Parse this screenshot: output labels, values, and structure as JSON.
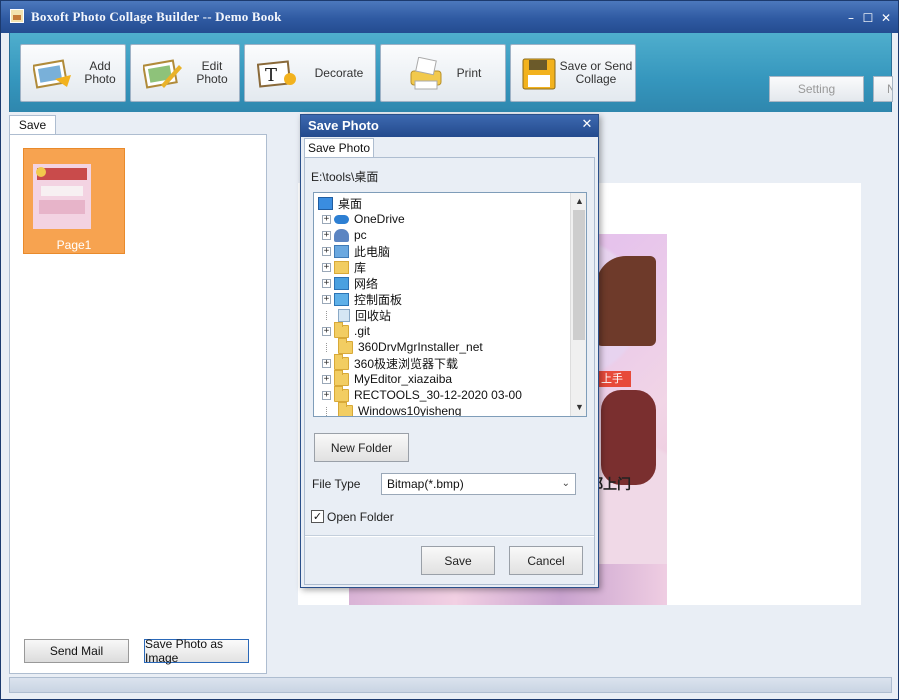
{
  "window": {
    "title": "Boxoft Photo Collage Builder -- Demo Book"
  },
  "toolbar": {
    "add_photo": "Add\nPhoto",
    "edit_photo": "Edit\nPhoto",
    "decorate": "Decorate",
    "print": "Print",
    "save_or_send": "Save or Send\nCollage",
    "setting": "Setting",
    "next_partial": "N"
  },
  "left_panel": {
    "tab": "Save",
    "thumbnail_caption": "Page1",
    "send_mail": "Send Mail",
    "save_photo_as_image": "Save Photo as Image"
  },
  "dialog": {
    "title": "Save Photo",
    "tab": "Save Photo",
    "path": "E:\\tools\\桌面",
    "tree": [
      {
        "label": "桌面",
        "icon": "desktop-icon",
        "level": 0,
        "expander": "none"
      },
      {
        "label": "OneDrive",
        "icon": "cloud-icon",
        "level": 1,
        "expander": "+"
      },
      {
        "label": "pc",
        "icon": "user-icon",
        "level": 1,
        "expander": "+"
      },
      {
        "label": "此电脑",
        "icon": "computer-icon",
        "level": 1,
        "expander": "+"
      },
      {
        "label": "库",
        "icon": "library-icon",
        "level": 1,
        "expander": "+"
      },
      {
        "label": "网络",
        "icon": "network-icon",
        "level": 1,
        "expander": "+"
      },
      {
        "label": "控制面板",
        "icon": "control-panel-icon",
        "level": 1,
        "expander": "+"
      },
      {
        "label": "回收站",
        "icon": "recycle-bin-icon",
        "level": 1,
        "expander": "none"
      },
      {
        "label": ".git",
        "icon": "folder-icon",
        "level": 1,
        "expander": "+"
      },
      {
        "label": "360DrvMgrInstaller_net",
        "icon": "folder-icon",
        "level": 1,
        "expander": "none"
      },
      {
        "label": "360极速浏览器下载",
        "icon": "folder-icon",
        "level": 1,
        "expander": "+"
      },
      {
        "label": "MyEditor_xiazaiba",
        "icon": "folder-icon",
        "level": 1,
        "expander": "+"
      },
      {
        "label": "RECTOOLS_30-12-2020 03-00",
        "icon": "folder-icon",
        "level": 1,
        "expander": "+"
      },
      {
        "label": "Windows10yisheng",
        "icon": "folder-icon",
        "level": 1,
        "expander": "none"
      }
    ],
    "new_folder": "New  Folder",
    "file_type_label": "File Type",
    "file_type_value": "Bitmap(*.bmp)",
    "open_folder_label": "Open Folder",
    "open_folder_checked": true,
    "save": "Save",
    "cancel": "Cancel"
  },
  "collage_preview": {
    "visible_text": [
      "上手",
      "都上门"
    ]
  }
}
